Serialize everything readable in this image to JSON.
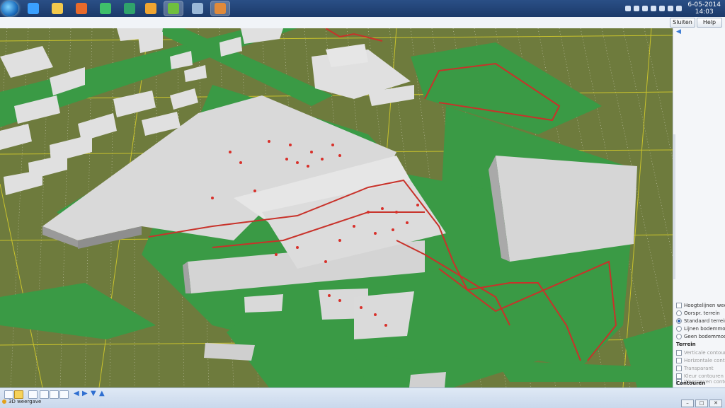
{
  "taskbar": {
    "apps": [
      {
        "icon": "internet-explorer-icon"
      },
      {
        "icon": "file-explorer-icon"
      },
      {
        "icon": "media-player-icon"
      },
      {
        "icon": "browser-icon"
      },
      {
        "icon": "gis-app-icon"
      },
      {
        "icon": "outlook-icon"
      },
      {
        "icon": "browser-active-icon"
      },
      {
        "icon": "settings-app-icon"
      },
      {
        "icon": "map-app-icon"
      }
    ],
    "clock_time": "14:03",
    "clock_date": "6-05-2014"
  },
  "app_header": {
    "btn1_label": "Sluiten",
    "btn2_label": "Help"
  },
  "panel": {
    "section_terrain": "Terrein",
    "options": [
      {
        "label": "Hoogtelijnen weergeven",
        "type": "checkbox",
        "checked": false
      },
      {
        "label": "Oorspr. terrein",
        "type": "radio",
        "checked": false
      },
      {
        "label": "Standaard terrein",
        "type": "radio",
        "checked": true
      },
      {
        "label": "Lijnen bodemmodel",
        "type": "radio",
        "checked": false
      },
      {
        "label": "Geen bodemmodel",
        "type": "radio",
        "checked": false
      }
    ],
    "section_contours": "Contouren",
    "contour_options": [
      {
        "label": "Verticale contouren",
        "type": "checkbox"
      },
      {
        "label": "Horizontale contouren",
        "type": "checkbox"
      },
      {
        "label": "Transparant",
        "type": "checkbox"
      },
      {
        "label": "Kleur contouren",
        "type": "checkbox"
      },
      {
        "label": "Weergeven contouren",
        "type": "checkbox"
      }
    ]
  },
  "statusbar": {
    "title": "3D weergave"
  },
  "colors": {
    "terrain": "#6e7b3d",
    "vegetation": "#3a9a45",
    "building": "#d9d9d9",
    "route": "#c8322a",
    "grid": "#e6d22b"
  }
}
